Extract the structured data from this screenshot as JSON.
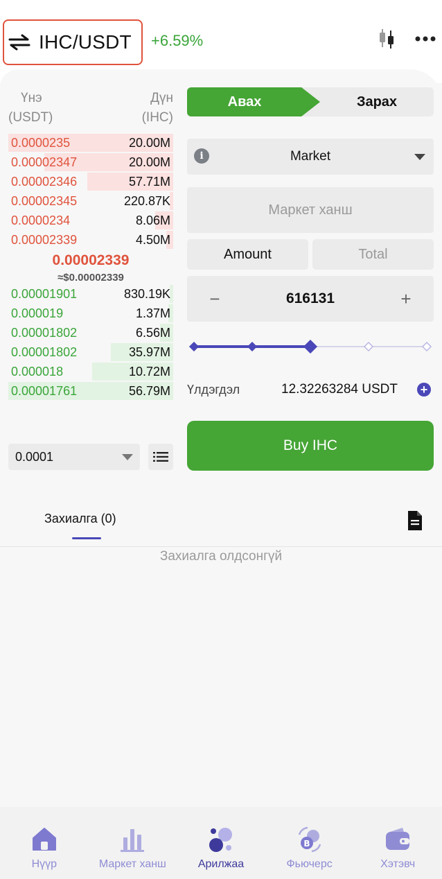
{
  "header": {
    "pair": "IHC/USDT",
    "change": "+6.59%"
  },
  "orderbook": {
    "price_label": "Үнэ",
    "price_unit": "(USDT)",
    "amount_label": "Дүн",
    "amount_unit": "(IHC)",
    "asks": [
      {
        "price": "0.0000235",
        "amount": "20.00M",
        "depth": 1.0
      },
      {
        "price": "0.00002347",
        "amount": "20.00M",
        "depth": 0.78
      },
      {
        "price": "0.00002346",
        "amount": "57.71M",
        "depth": 0.52
      },
      {
        "price": "0.00002345",
        "amount": "220.87K",
        "depth": 0.02
      },
      {
        "price": "0.0000234",
        "amount": "8.06M",
        "depth": 0.11
      },
      {
        "price": "0.00002339",
        "amount": "4.50M",
        "depth": 0.04
      }
    ],
    "last_price": "0.00002339",
    "last_price_usd": "≈$0.00002339",
    "bids": [
      {
        "price": "0.00001901",
        "amount": "830.19K",
        "depth": 0.02
      },
      {
        "price": "0.000019",
        "amount": "1.37M",
        "depth": 0.03
      },
      {
        "price": "0.00001802",
        "amount": "6.56M",
        "depth": 0.08
      },
      {
        "price": "0.00001802",
        "amount": "35.97M",
        "depth": 0.38
      },
      {
        "price": "0.000018",
        "amount": "10.72M",
        "depth": 0.49
      },
      {
        "price": "0.00001761",
        "amount": "56.79M",
        "depth": 1.0
      }
    ],
    "precision": "0.0001"
  },
  "trade": {
    "buy_tab": "Авах",
    "sell_tab": "Зарах",
    "order_type": "Market",
    "market_price_placeholder": "Маркет ханш",
    "amount_tab": "Amount",
    "total_tab": "Total",
    "quantity": "616131",
    "slider_percent": 50,
    "balance_label": "Үлдэгдэл",
    "balance_value": "12.32263284 USDT",
    "buy_button": "Buy IHC"
  },
  "orders": {
    "tab_label": "Захиалга (0)",
    "empty_text": "Захиалга олдсонгүй"
  },
  "nav": {
    "items": [
      {
        "label": "Нүүр",
        "icon": "home-icon"
      },
      {
        "label": "Маркет ханш",
        "icon": "market-chart-icon"
      },
      {
        "label": "Арилжаа",
        "icon": "trade-icon"
      },
      {
        "label": "Фьючерс",
        "icon": "futures-icon"
      },
      {
        "label": "Хэтэвч",
        "icon": "wallet-icon"
      }
    ],
    "active": 2
  },
  "colors": {
    "accent": "#4a48b8",
    "buy": "#45a535",
    "sell": "#e0533d"
  }
}
